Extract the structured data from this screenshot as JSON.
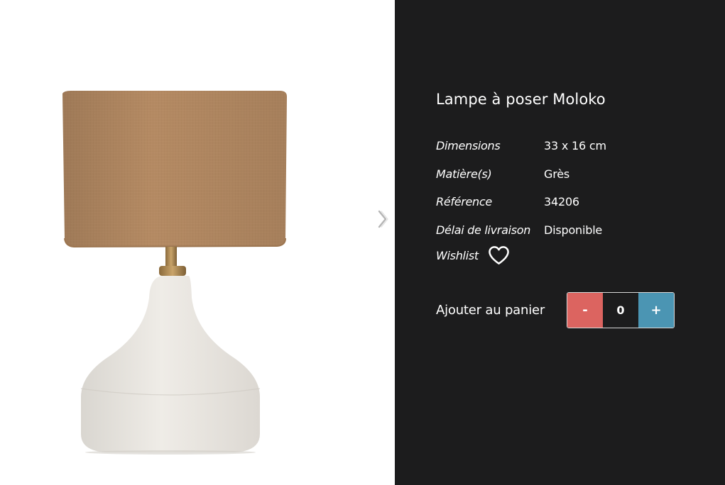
{
  "product": {
    "title": "Lampe à poser Moloko",
    "image_icon": "table-lamp-image"
  },
  "specs": [
    {
      "label": "Dimensions",
      "value": "33 x 16 cm"
    },
    {
      "label": "Matière(s)",
      "value": "Grès"
    },
    {
      "label": "Référence",
      "value": "34206"
    },
    {
      "label": "Délai de livraison",
      "value": "Disponible"
    }
  ],
  "wishlist": {
    "label": "Wishlist",
    "icon": "heart-outline-icon"
  },
  "cart": {
    "label": "Ajouter au panier",
    "minus_label": "-",
    "plus_label": "+",
    "quantity": "0"
  },
  "gallery": {
    "next_icon": "chevron-right-icon"
  },
  "colors": {
    "panel_bg": "#1c1c1d",
    "minus_bg": "#dc6460",
    "plus_bg": "#4b95b3",
    "shade": "#b48a63",
    "ceramic": "#ece9e4"
  }
}
